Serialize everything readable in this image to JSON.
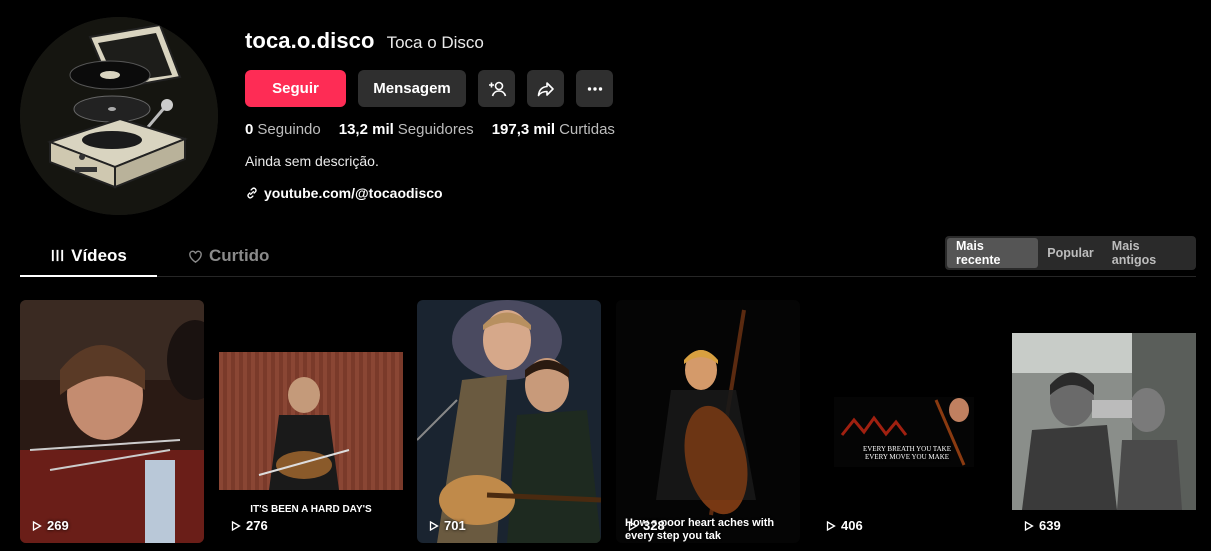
{
  "profile": {
    "username": "toca.o.disco",
    "nickname": "Toca o Disco",
    "follow_label": "Seguir",
    "message_label": "Mensagem",
    "stats": {
      "following_count": "0",
      "following_label": "Seguindo",
      "followers_count": "13,2 mil",
      "followers_label": "Seguidores",
      "likes_count": "197,3 mil",
      "likes_label": "Curtidas"
    },
    "bio": "Ainda sem descrição.",
    "link": "youtube.com/@tocaodisco"
  },
  "tabs": {
    "videos": "Vídeos",
    "liked": "Curtido"
  },
  "sort": {
    "recent": "Mais recente",
    "popular": "Popular",
    "oldest": "Mais antigos"
  },
  "videos": [
    {
      "views": "269",
      "caption": ""
    },
    {
      "views": "276",
      "caption": "IT'S BEEN A HARD DAY'S"
    },
    {
      "views": "701",
      "caption": ""
    },
    {
      "views": "328",
      "caption": "How s poor heart aches with every step you tak"
    },
    {
      "views": "406",
      "caption": "EVERY BREATH YOU TAKE EVERY MOVE YOU MAKE"
    },
    {
      "views": "639",
      "caption": ""
    }
  ],
  "colors": {
    "accent": "#fe2c55",
    "background": "#000000",
    "button_dark": "#2f2f2f"
  }
}
